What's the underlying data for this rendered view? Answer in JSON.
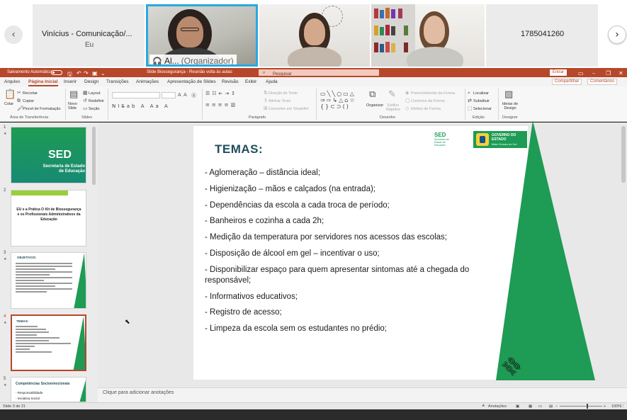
{
  "meeting": {
    "participants": [
      {
        "name": "Vinícius - Comunicação/...",
        "subtitle": "Eu"
      },
      {
        "name": "Al...",
        "role": "(Organizador)"
      },
      {
        "id": "1785041260"
      }
    ],
    "nav_prev": "‹",
    "nav_next": "›"
  },
  "app": {
    "autosave_label": "Salvamento Automático",
    "document_title": "Slide Biossegurança - Reunião volta às aulas",
    "search_placeholder": "Pesquisar",
    "enter_label": "Entrar",
    "share_label": "Compartilhar",
    "comments_label": "Comentários"
  },
  "ribbon_tabs": [
    "Arquivo",
    "Página Inicial",
    "Inserir",
    "Design",
    "Transições",
    "Animações",
    "Apresentação de Slides",
    "Revisão",
    "Exibir",
    "Ajuda"
  ],
  "ribbon": {
    "paste": "Colar",
    "cut": "Recortar",
    "copy": "Copiar",
    "format_painter": "Pincel de Formatação",
    "clipboard_group": "Área de Transferência",
    "new_slide": "Novo Slide",
    "layout": "Layout",
    "reset": "Redefinir",
    "section": "Seção",
    "slides_group": "Slides",
    "paragraph_group": "Parágrafo",
    "text_direction": "Direção do Texto",
    "align_text": "Alinhar Texto",
    "smartart": "Converter em SmartArt",
    "arrange": "Organizar",
    "quick_styles": "Estilos Rápidos",
    "shape_fill": "Preenchimento da Forma",
    "shape_outline": "Contorno da Forma",
    "shape_effects": "Efeitos de Forma",
    "drawing_group": "Desenho",
    "find": "Localizar",
    "replace": "Substituir",
    "select": "Selecionar",
    "editing_group": "Edição",
    "design_ideas": "Ideias de Design",
    "designer_group": "Designer"
  },
  "thumbnails": [
    {
      "num": "1",
      "title": "SED",
      "subtitle": "Secretaria de Estado de Educação"
    },
    {
      "num": "2",
      "title": "EU e a Prática O Kit de Biossegurança e os Profissionais Administrativos da Educação"
    },
    {
      "num": "3",
      "title": "OBJETIVOS:"
    },
    {
      "num": "4",
      "title": "TEMAS:"
    },
    {
      "num": "5",
      "title": "Competências Socioemocionais",
      "items": [
        "- Responsabilidade",
        "- Iniciativa Social"
      ]
    }
  ],
  "slide": {
    "title": "TEMAS:",
    "logo_sed": "SED",
    "logo_sed_sub": "Secretaria de Estado de Educação",
    "logo_gov": "GOVERNO DO ESTADO",
    "logo_gov_sub": "Mato Grosso do Sul",
    "items": [
      "- Aglomeração – distância ideal;",
      "- Higienização – mãos e calçados (na entrada);",
      "- Dependências da escola a cada troca de período;",
      "- Banheiros e cozinha a cada 2h;",
      "- Medição da temperatura por servidores nos acessos das escolas;",
      "- Disposição de álcool em gel – incentivar o uso;",
      "- Disponibilizar espaço para quem apresentar sintomas até a chegada do responsável;",
      "- Informativos educativos;",
      "- Registro de acesso;",
      "- Limpeza da escola sem os estudantes no prédio;"
    ]
  },
  "notes_placeholder": "Clique para adicionar anotações",
  "status": {
    "slide_count": "Slide 3 de 21",
    "notes_label": "Anotações",
    "zoom": "100%"
  },
  "colors": {
    "accent": "#b7472a",
    "slide_title": "#1f4e5c",
    "brand_green": "#1e9b54"
  }
}
